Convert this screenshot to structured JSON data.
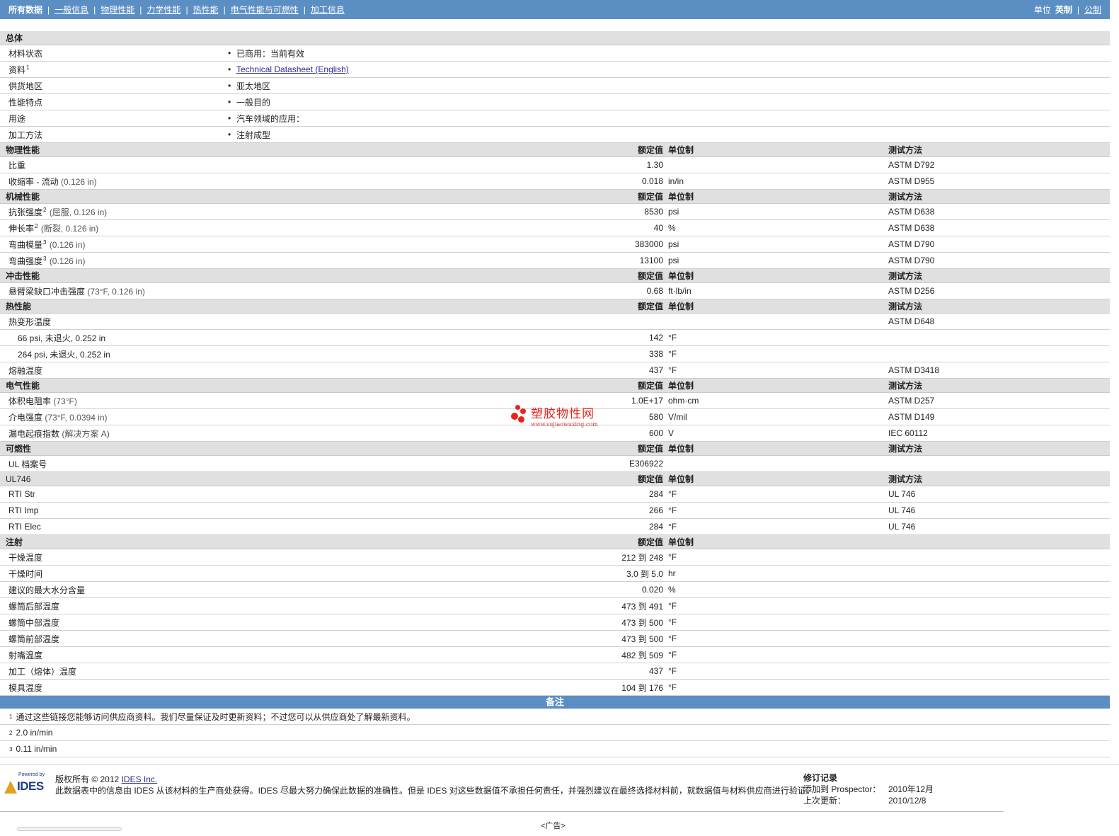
{
  "nav": {
    "tabs": [
      "所有数据",
      "一般信息",
      "物理性能",
      "力学性能",
      "热性能",
      "电气性能与可燃性",
      "加工信息"
    ],
    "unit_label": "单位",
    "unit_imperial": "英制",
    "unit_metric": "公制"
  },
  "general": {
    "title": "总体",
    "rows": [
      {
        "label": "材料状态",
        "sup": "",
        "value": "已商用：当前有效",
        "link": false
      },
      {
        "label": "资料",
        "sup": "1",
        "value": "Technical Datasheet (English)",
        "link": true
      },
      {
        "label": "供货地区",
        "sup": "",
        "value": "亚太地区",
        "link": false
      },
      {
        "label": "性能特点",
        "sup": "",
        "value": "一般目的",
        "link": false
      },
      {
        "label": "用途",
        "sup": "",
        "value": "汽车领域的应用：",
        "link": false
      },
      {
        "label": "加工方法",
        "sup": "",
        "value": "注射成型",
        "link": false
      }
    ]
  },
  "headers": {
    "value": "额定值",
    "unit": "单位制",
    "test": "测试方法"
  },
  "sections": [
    {
      "title": "物理性能",
      "show_test": true,
      "rows": [
        {
          "label": "比重",
          "sup": "",
          "cond": "",
          "value": "1.30",
          "unit": "",
          "test": "ASTM D792"
        },
        {
          "label": "收缩率 - 流动",
          "sup": "",
          "cond": "(0.126 in)",
          "value": "0.018",
          "unit": "in/in",
          "test": "ASTM D955"
        }
      ]
    },
    {
      "title": "机械性能",
      "show_test": true,
      "rows": [
        {
          "label": "抗张强度",
          "sup": "2",
          "cond": "(屈服, 0.126 in)",
          "value": "8530",
          "unit": "psi",
          "test": "ASTM D638"
        },
        {
          "label": "伸长率",
          "sup": "2",
          "cond": "(断裂, 0.126 in)",
          "value": "40",
          "unit": "%",
          "test": "ASTM D638"
        },
        {
          "label": "弯曲模量",
          "sup": "3",
          "cond": "(0.126 in)",
          "value": "383000",
          "unit": "psi",
          "test": "ASTM D790"
        },
        {
          "label": "弯曲强度",
          "sup": "3",
          "cond": "(0.126 in)",
          "value": "13100",
          "unit": "psi",
          "test": "ASTM D790"
        }
      ]
    },
    {
      "title": "冲击性能",
      "show_test": true,
      "rows": [
        {
          "label": "悬臂梁缺口冲击强度",
          "sup": "",
          "cond": "(73°F, 0.126 in)",
          "value": "0.68",
          "unit": "ft·lb/in",
          "test": "ASTM D256"
        }
      ]
    },
    {
      "title": "热性能",
      "show_test": true,
      "rows": [
        {
          "label": "热变形温度",
          "sup": "",
          "cond": "",
          "value": "",
          "unit": "",
          "test": "ASTM D648"
        },
        {
          "label": "66 psi, 未退火, 0.252 in",
          "sub": true,
          "sup": "",
          "cond": "",
          "value": "142",
          "unit": "°F",
          "test": ""
        },
        {
          "label": "264 psi, 未退火, 0.252 in",
          "sub": true,
          "sup": "",
          "cond": "",
          "value": "338",
          "unit": "°F",
          "test": ""
        },
        {
          "label": "熔融温度",
          "sup": "",
          "cond": "",
          "value": "437",
          "unit": "°F",
          "test": "ASTM D3418"
        }
      ]
    },
    {
      "title": "电气性能",
      "show_test": true,
      "rows": [
        {
          "label": "体积电阻率",
          "sup": "",
          "cond": "(73°F)",
          "value": "1.0E+17",
          "unit": "ohm·cm",
          "test": "ASTM D257"
        },
        {
          "label": "介电强度",
          "sup": "",
          "cond": "(73°F, 0.0394 in)",
          "value": "580",
          "unit": "V/mil",
          "test": "ASTM D149"
        },
        {
          "label": "漏电起痕指数",
          "sup": "",
          "cond": "(解决方案 A)",
          "value": "600",
          "unit": "V",
          "test": "IEC 60112"
        }
      ]
    },
    {
      "title": "可燃性",
      "show_test": true,
      "rows": [
        {
          "label": "UL 档案号",
          "sup": "",
          "cond": "",
          "value": "E306922",
          "unit": "",
          "test": ""
        }
      ]
    },
    {
      "title": "UL746",
      "plain": true,
      "show_test": true,
      "rows": [
        {
          "label": "RTI Str",
          "sup": "",
          "cond": "",
          "value": "284",
          "unit": "°F",
          "test": "UL 746"
        },
        {
          "label": "RTI Imp",
          "sup": "",
          "cond": "",
          "value": "266",
          "unit": "°F",
          "test": "UL 746"
        },
        {
          "label": "RTI Elec",
          "sup": "",
          "cond": "",
          "value": "284",
          "unit": "°F",
          "test": "UL 746"
        }
      ]
    },
    {
      "title": "注射",
      "show_test": false,
      "rows": [
        {
          "label": "干燥温度",
          "sup": "",
          "cond": "",
          "value": "212 到 248",
          "unit": "°F",
          "test": ""
        },
        {
          "label": "干燥时间",
          "sup": "",
          "cond": "",
          "value": "3.0 到 5.0",
          "unit": "hr",
          "test": ""
        },
        {
          "label": "建议的最大水分含量",
          "sup": "",
          "cond": "",
          "value": "0.020",
          "unit": "%",
          "test": ""
        },
        {
          "label": "螺筒后部温度",
          "sup": "",
          "cond": "",
          "value": "473 到 491",
          "unit": "°F",
          "test": ""
        },
        {
          "label": "螺筒中部温度",
          "sup": "",
          "cond": "",
          "value": "473 到 500",
          "unit": "°F",
          "test": ""
        },
        {
          "label": "螺筒前部温度",
          "sup": "",
          "cond": "",
          "value": "473 到 500",
          "unit": "°F",
          "test": ""
        },
        {
          "label": "射嘴温度",
          "sup": "",
          "cond": "",
          "value": "482 到 509",
          "unit": "°F",
          "test": ""
        },
        {
          "label": "加工（熔体）温度",
          "sup": "",
          "cond": "",
          "value": "437",
          "unit": "°F",
          "test": ""
        },
        {
          "label": "模具温度",
          "sup": "",
          "cond": "",
          "value": "104 到 176",
          "unit": "°F",
          "test": ""
        }
      ]
    }
  ],
  "notes": {
    "title": "备注",
    "items": [
      {
        "num": "1",
        "text": "通过这些链接您能够访问供应商资料。我们尽量保证及时更新资料；不过您可以从供应商处了解最新资料。"
      },
      {
        "num": "2",
        "text": "2.0 in/min"
      },
      {
        "num": "3",
        "text": "0.11 in/min"
      }
    ]
  },
  "watermark": {
    "title": "塑胶物性网",
    "url": "www.sujiaowuxing.com"
  },
  "footer": {
    "logo_powered": "Powered by",
    "logo_name": "IDES",
    "copyright_prefix": "版权所有 © 2012",
    "copyright_link": "IDES Inc.",
    "disclaimer": "此数据表中的信息由 IDES 从该材料的生产商处获得。IDES 尽最大努力确保此数据的准确性。但是 IDES 对这些数据值不承担任何责任，并强烈建议在最终选择材料前，就数据值与材料供应商进行验证。",
    "revision_title": "修订记录",
    "added_label": "添加到 Prospector：",
    "added_value": "2010年12月",
    "updated_label": "上次更新：",
    "updated_value": "2010/12/8",
    "ad": "<广告>"
  }
}
